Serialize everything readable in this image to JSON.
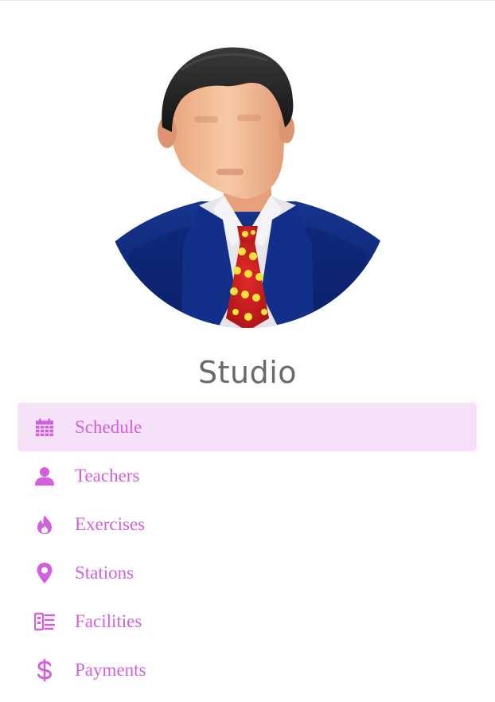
{
  "profile": {
    "avatar_icon": "businessman-avatar-icon",
    "name": "Studio"
  },
  "theme": {
    "accent": "#d25fdc",
    "active_bg": "#f6e2f8",
    "title_color": "#6a6a6a"
  },
  "menu": {
    "items": [
      {
        "label": "Schedule",
        "icon": "calendar-icon",
        "active": true
      },
      {
        "label": "Teachers",
        "icon": "person-icon",
        "active": false
      },
      {
        "label": "Exercises",
        "icon": "flame-icon",
        "active": false
      },
      {
        "label": "Stations",
        "icon": "map-pin-icon",
        "active": false
      },
      {
        "label": "Facilities",
        "icon": "facilities-icon",
        "active": false
      },
      {
        "label": "Payments",
        "icon": "dollar-icon",
        "active": false
      }
    ]
  }
}
